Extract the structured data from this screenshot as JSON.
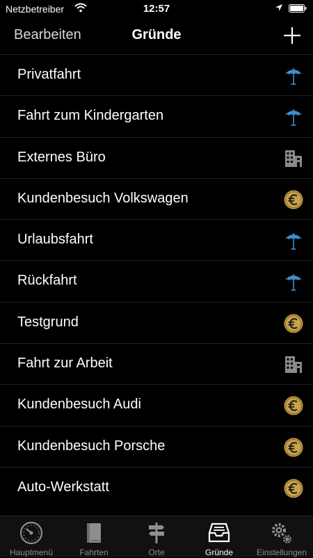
{
  "status_bar": {
    "carrier": "Netzbetreiber",
    "time": "12:57"
  },
  "nav": {
    "edit_label": "Bearbeiten",
    "title": "Gründe",
    "add_icon": "plus-icon"
  },
  "reasons": [
    {
      "label": "Privatfahrt",
      "icon": "umbrella-icon"
    },
    {
      "label": "Fahrt zum Kindergarten",
      "icon": "umbrella-icon"
    },
    {
      "label": "Externes Büro",
      "icon": "building-icon"
    },
    {
      "label": "Kundenbesuch Volkswagen",
      "icon": "euro-coin-icon"
    },
    {
      "label": "Urlaubsfahrt",
      "icon": "umbrella-icon"
    },
    {
      "label": "Rückfahrt",
      "icon": "umbrella-icon"
    },
    {
      "label": "Testgrund",
      "icon": "euro-coin-icon"
    },
    {
      "label": "Fahrt zur Arbeit",
      "icon": "building-icon"
    },
    {
      "label": "Kundenbesuch Audi",
      "icon": "euro-coin-icon"
    },
    {
      "label": "Kundenbesuch Porsche",
      "icon": "euro-coin-icon"
    },
    {
      "label": "Auto-Werkstatt",
      "icon": "euro-coin-icon"
    }
  ],
  "tabs": [
    {
      "label": "Hauptmenü",
      "icon": "speedometer-icon"
    },
    {
      "label": "Fahrten",
      "icon": "book-icon"
    },
    {
      "label": "Orte",
      "icon": "signpost-icon"
    },
    {
      "label": "Gründe",
      "icon": "inbox-tray-icon",
      "active": true
    },
    {
      "label": "Einstellungen",
      "icon": "gears-icon"
    }
  ],
  "colors": {
    "background": "#000000",
    "umbrella": "#3b8fd0",
    "euro_coin": "#c9a24a",
    "building": "#8a8a8a"
  }
}
